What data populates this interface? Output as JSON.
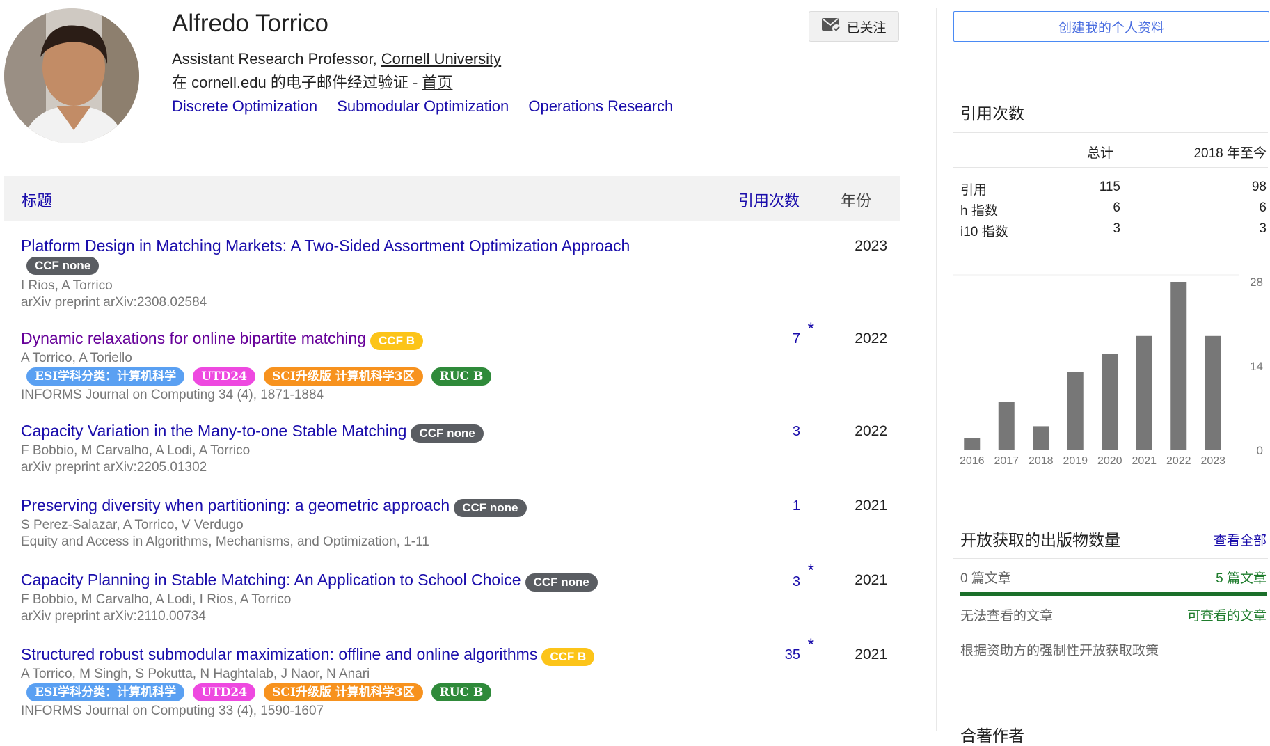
{
  "profile": {
    "name": "Alfredo Torrico",
    "affiliation_prefix": "Assistant Research Professor, ",
    "affiliation_link": "Cornell University",
    "verify_prefix": "在 cornell.edu 的电子邮件经过验证 - ",
    "homepage": "首页",
    "interests": [
      "Discrete Optimization",
      "Submodular Optimization",
      "Operations Research"
    ],
    "follow_label": "已关注"
  },
  "table": {
    "col_title": "标题",
    "col_cited": "引用次数",
    "col_year": "年份"
  },
  "papers": [
    {
      "title": "Platform Design in Matching Markets: A Two-Sided Assortment Optimization Approach",
      "badge": "CCF none",
      "authors": "I Rios, A Torrico",
      "venue": "arXiv preprint arXiv:2308.02584",
      "cited": "",
      "star": "",
      "year": "2023"
    },
    {
      "title": "Dynamic relaxations for online bipartite matching",
      "badge": "CCF B",
      "authors": "A Torrico, A Toriello",
      "venue": "INFORMS Journal on Computing 34 (4), 1871-1884",
      "cited": "7",
      "star": "*",
      "year": "2022",
      "tags": [
        "ESI学科分类：计算机科学",
        "UTD24",
        "SCI升级版 计算机科学3区",
        "RUC B"
      ]
    },
    {
      "title": "Capacity Variation in the Many-to-one Stable Matching",
      "badge": "CCF none",
      "authors": "F Bobbio, M Carvalho, A Lodi, A Torrico",
      "venue": "arXiv preprint arXiv:2205.01302",
      "cited": "3",
      "star": "",
      "year": "2022"
    },
    {
      "title": "Preserving diversity when partitioning: a geometric approach",
      "badge": "CCF none",
      "authors": "S Perez-Salazar, A Torrico, V Verdugo",
      "venue": "Equity and Access in Algorithms, Mechanisms, and Optimization, 1-11",
      "cited": "1",
      "star": "",
      "year": "2021"
    },
    {
      "title": "Capacity Planning in Stable Matching: An Application to School Choice",
      "badge": "CCF none",
      "authors": "F Bobbio, M Carvalho, A Lodi, I Rios, A Torrico",
      "venue": "arXiv preprint arXiv:2110.00734",
      "cited": "3",
      "star": "*",
      "year": "2021"
    },
    {
      "title": "Structured robust submodular maximization: offline and online algorithms",
      "badge": "CCF B",
      "authors": "A Torrico, M Singh, S Pokutta, N Haghtalab, J Naor, N Anari",
      "venue": "INFORMS Journal on Computing 33 (4), 1590-1607",
      "cited": "35",
      "star": "*",
      "year": "2021",
      "tags": [
        "ESI学科分类：计算机科学",
        "UTD24",
        "SCI升级版 计算机科学3区",
        "RUC B"
      ]
    }
  ],
  "sidebar": {
    "create_profile": "创建我的个人资料",
    "citations_title": "引用次数",
    "col_total": "总计",
    "col_since": "2018 年至今",
    "stats": [
      {
        "label": "引用",
        "total": "115",
        "since": "98"
      },
      {
        "label": "h 指数",
        "total": "6",
        "since": "6"
      },
      {
        "label": "i10 指数",
        "total": "3",
        "since": "3"
      }
    ],
    "open_access_title": "开放获取的出版物数量",
    "view_all": "查看全部",
    "unavailable_count": "0 篇文章",
    "available_count": "5 篇文章",
    "unavailable_label": "无法查看的文章",
    "available_label": "可查看的文章",
    "mandate_text": "根据资助方的强制性开放获取政策",
    "coauthors_title": "合著作者"
  },
  "chart_data": {
    "type": "bar",
    "categories": [
      "2016",
      "2017",
      "2018",
      "2019",
      "2020",
      "2021",
      "2022",
      "2023"
    ],
    "values": [
      2,
      8,
      4,
      13,
      16,
      19,
      28,
      19
    ],
    "yticks": [
      "28",
      "14",
      "0"
    ],
    "ylim": [
      0,
      28
    ],
    "bar_color": "#777777"
  }
}
